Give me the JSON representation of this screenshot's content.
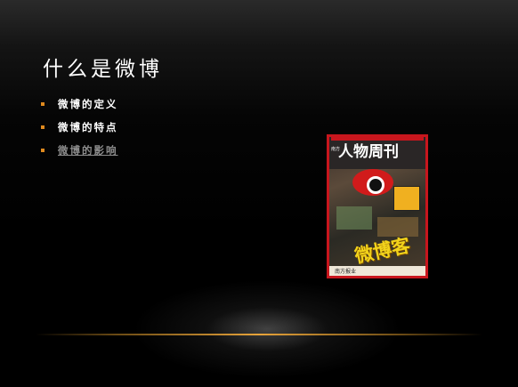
{
  "slide": {
    "title": "什么是微博",
    "bullets": [
      {
        "label": "微博的定义"
      },
      {
        "label": "微博的特点"
      },
      {
        "label": "微博的影响"
      }
    ],
    "magazine": {
      "prefix": "南方",
      "brand": "人物周刊",
      "feature": "微博客",
      "footer": "南方报业"
    },
    "colors": {
      "background": "#000000",
      "title": "#ffffff",
      "bullet_marker": "#e08a1e",
      "link": "#8c8c8c",
      "accent_line": "#e8a43a",
      "magazine_border": "#c8161d"
    }
  }
}
